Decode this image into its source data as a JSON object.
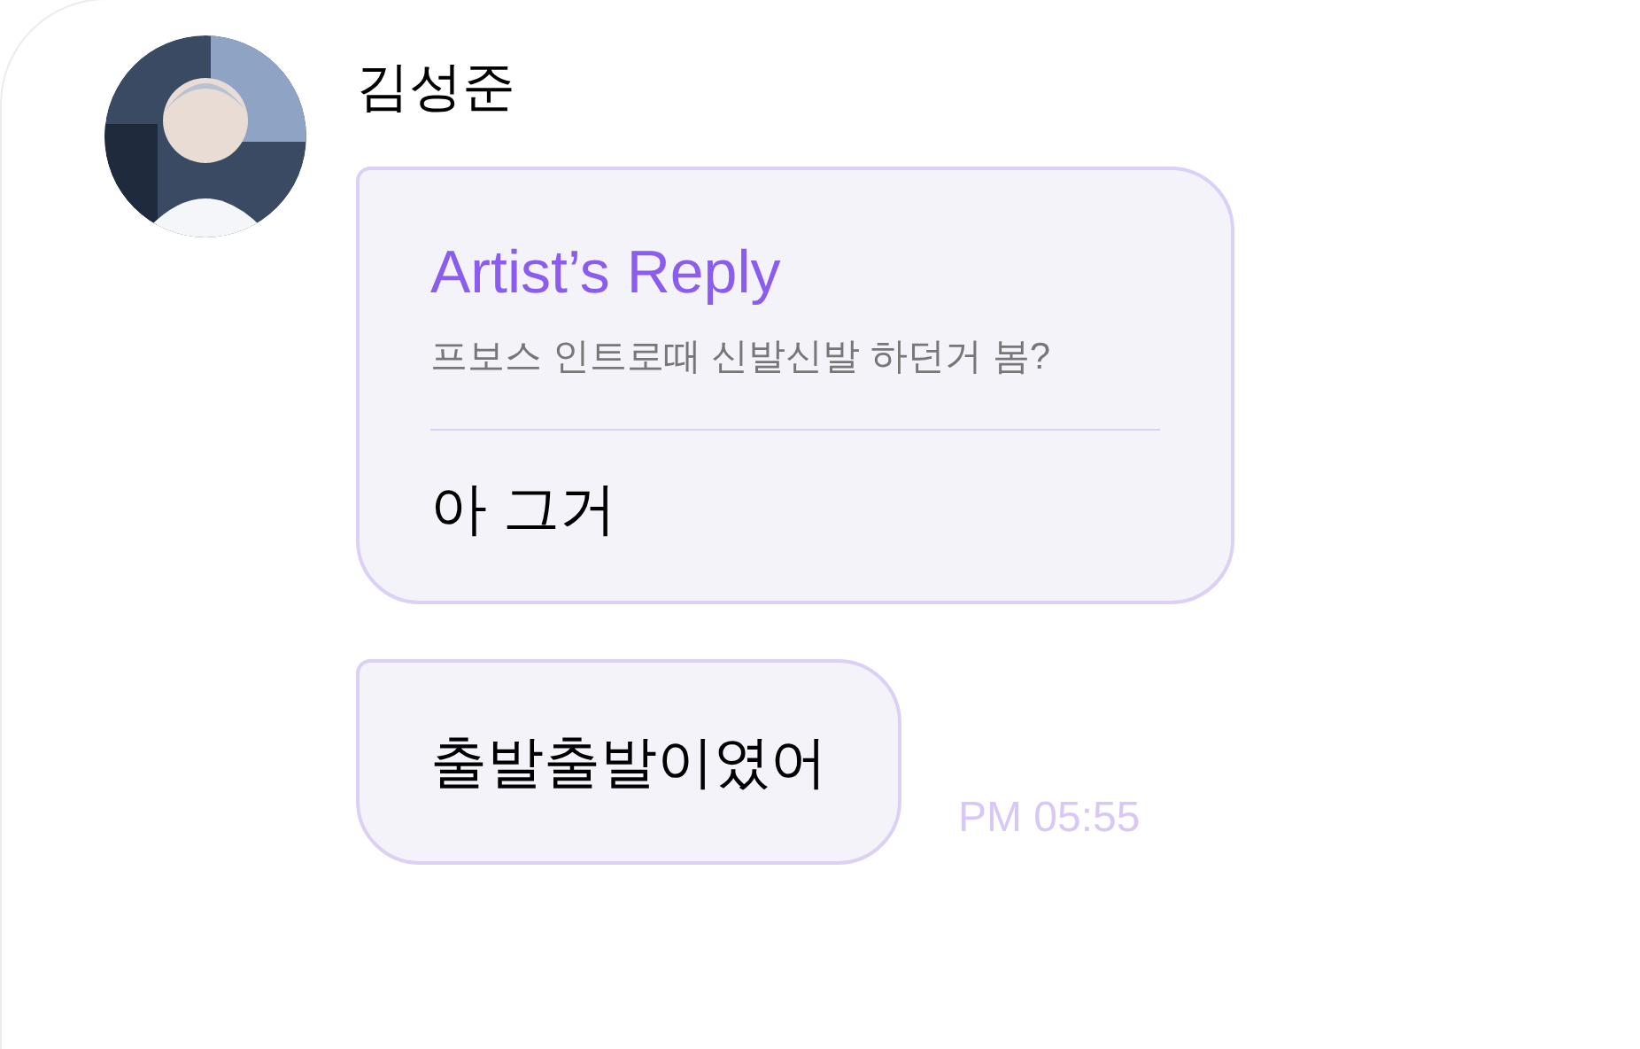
{
  "message": {
    "sender": "김성준",
    "reply": {
      "title": "Artist’s Reply",
      "quoted": "프보스 인트로때 신발신발 하던거 봄?",
      "text": "아 그거"
    },
    "bubbles": [
      {
        "text": "출발출발이였어"
      }
    ],
    "time": "PM 05:55"
  }
}
